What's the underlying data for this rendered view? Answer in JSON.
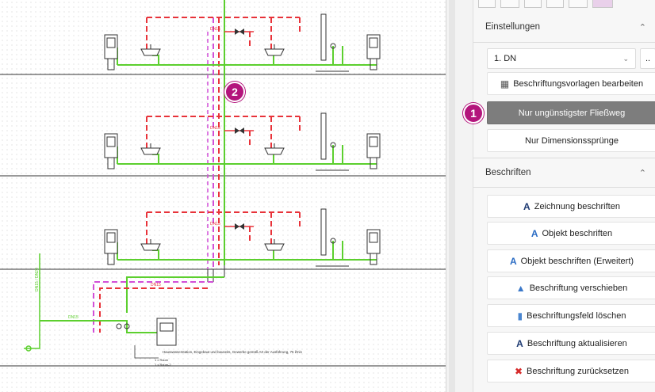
{
  "panel": {
    "settings": {
      "title": "Einstellungen",
      "collapse_icon": "chevron-up-icon",
      "dropdown_value": "1. DN",
      "more_label": "..",
      "buttons": [
        {
          "label": "Beschriftungsvorlagen bearbeiten",
          "icon": "template-edit-icon",
          "active": false
        },
        {
          "label": "Nur ungünstigster Fließweg",
          "icon": "",
          "active": true
        },
        {
          "label": "Nur Dimensionssprünge",
          "icon": "",
          "active": false
        }
      ]
    },
    "label": {
      "title": "Beschriften",
      "collapse_icon": "chevron-up-icon",
      "buttons": [
        {
          "label": "Zeichnung beschriften",
          "icon": "label-drawing-icon"
        },
        {
          "label": "Objekt beschriften",
          "icon": "label-object-icon"
        },
        {
          "label": "Objekt beschriften (Erweitert)",
          "icon": "label-object-advanced-icon"
        },
        {
          "label": "Beschriftung verschieben",
          "icon": "move-label-icon"
        },
        {
          "label": "Beschriftungsfeld löschen",
          "icon": "eraser-icon"
        },
        {
          "label": "Beschriftung aktualisieren",
          "icon": "refresh-label-icon"
        },
        {
          "label": "Beschriftung zurücksetzen",
          "icon": "reset-x-icon"
        }
      ]
    }
  },
  "callouts": {
    "one": "1",
    "two": "2"
  },
  "drawing": {
    "dn_label": "DN15",
    "dn20_label": "DN20",
    "legend_text": "Hauswasserstation, Eingebaut und bauseits, Gewerbe gemäß Art der Ausführung, 75 l/min",
    "legend_line2": "1 x  Raum",
    "legend_line3": "1 x  Raum-2",
    "small_left": "DN15 / DN20",
    "meter_label": "Filter",
    "pipe_colors": {
      "cold": "#5ccf2e",
      "hot": "#e8333a",
      "circ": "#d24fd8",
      "line": "#333333"
    }
  }
}
